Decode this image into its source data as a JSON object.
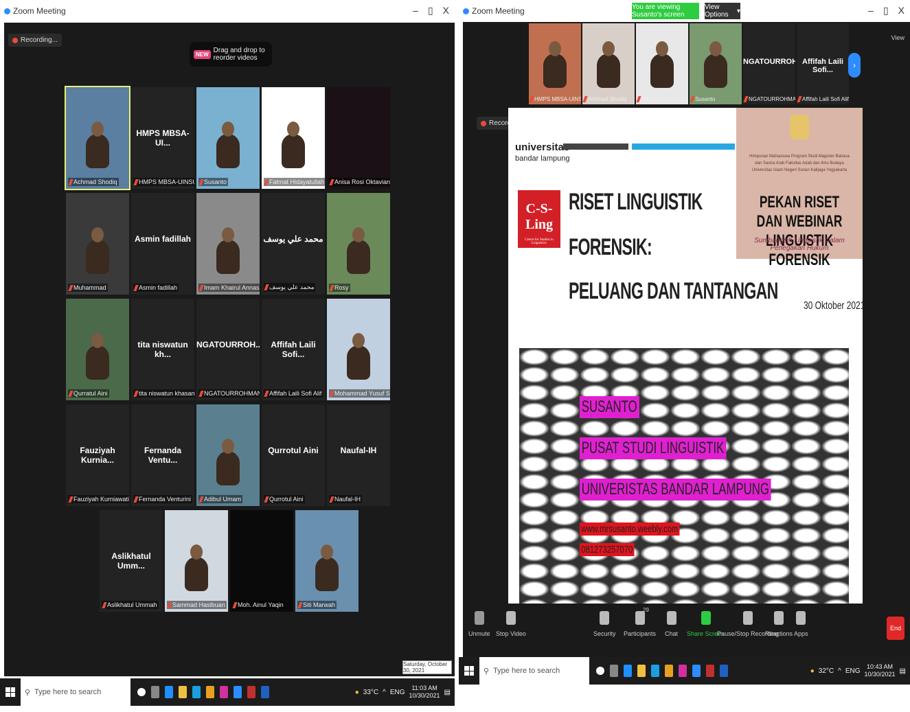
{
  "left": {
    "window_title": "Zoom Meeting",
    "recording_label": "Recording...",
    "drag_badge": "NEW",
    "drag_text": "Drag and drop to reorder videos",
    "tiles": [
      {
        "center": "",
        "name": "Achmad Shodiq"
      },
      {
        "center": "HMPS MBSA-UI...",
        "name": "HMPS MBSA-UINSUKA"
      },
      {
        "center": "",
        "name": "Susanto"
      },
      {
        "center": "",
        "name": "Fatmat Hidayatullah"
      },
      {
        "center": "",
        "name": "Anisa Rosi Oktaviana"
      },
      {
        "center": "",
        "name": "Muhammad"
      },
      {
        "center": "Asmin fadillah",
        "name": "Asmin fadillah"
      },
      {
        "center": "",
        "name": "Imam Khairul Annas"
      },
      {
        "center": "محمد علي يوسف",
        "name": "محمد علي يوسف"
      },
      {
        "center": "",
        "name": "Rosy"
      },
      {
        "center": "",
        "name": "Qurratul Aini"
      },
      {
        "center": "tita niswatun kh...",
        "name": "tita niswatun khasanah"
      },
      {
        "center": "NGATOURROH...",
        "name": "NGATOURROHMAN"
      },
      {
        "center": "Affifah Laili Sofi...",
        "name": "Affifah Laili Sofi Alif"
      },
      {
        "center": "",
        "name": "Mohammad Yusuf Setyawan"
      },
      {
        "center": "Fauziyah Kurnia...",
        "name": "Fauziyah Kurniawati"
      },
      {
        "center": "Fernanda Ventu...",
        "name": "Fernanda Venturini"
      },
      {
        "center": "",
        "name": "Adibul Umam"
      },
      {
        "center": "Qurrotul Aini",
        "name": "Qurrotul Aini"
      },
      {
        "center": "Naufal-IH",
        "name": "Naufal-IH"
      },
      {
        "center": "Aslikhatul Umm...",
        "name": "Aslikhatul Ummah"
      },
      {
        "center": "",
        "name": "Sammad Hasibuan"
      },
      {
        "center": "",
        "name": "Moh. Ainul Yaqin"
      },
      {
        "center": "",
        "name": "Siti Marwah"
      }
    ],
    "date_popup": "Saturday, October 30, 2021",
    "taskbar": {
      "search_placeholder": "Type here to search",
      "temp": "33°C",
      "lang": "ENG",
      "time": "11:03 AM",
      "date": "10/30/2021"
    }
  },
  "right": {
    "window_title": "Zoom Meeting",
    "viewing_label": "You are viewing Susanto's screen",
    "view_options": "View Options",
    "view_label": "View",
    "recording_label": "Recording...",
    "strip": [
      {
        "center": "",
        "name": "HMPS MBSA-UINSUKA"
      },
      {
        "center": "",
        "name": "Achmad Shodiq"
      },
      {
        "center": "",
        "name": "Fatmat Hidayatullah"
      },
      {
        "center": "",
        "name": "Susanto"
      },
      {
        "center": "NGATOURROH...",
        "name": "NGATOURROHMAN"
      },
      {
        "center": "Affifah Laili Sofi...",
        "name": "Affifah Laili Sofi Alif"
      }
    ],
    "slide": {
      "uni_line1": "universitas",
      "uni_line2": "bandar lampung",
      "csl_title": "C-S-Ling",
      "csl_sub": "Centre for Studies in Linguistics",
      "title1": "RISET LINGUISTIK",
      "title2": "FORENSIK:",
      "title3": "PELUANG DAN TANTANGAN",
      "poster_lines": "Himpunan Mahasiswa Program Studi Magister Bahasa dan Sastra Arab Fakultas Adab dan Ilmu Budaya Universitas Islam Negeri Sunan Kalijaga Yogyakarta",
      "poster_big": "PEKAN RISET DAN WEBINAR LINGUISTIK FORENSIK",
      "poster_sub": "Sumbangsih Linguistik Dalam Penegakan Hukum",
      "date": "30 Oktober 2021",
      "name": "SUSANTO",
      "org": "PUSAT STUDI LINGUISTIK",
      "univ": "UNIVERISTAS BANDAR LAMPUNG",
      "site": "www.mrsusanto.weebly.com",
      "phone": "081273257070"
    },
    "toolbar": {
      "unmute": "Unmute",
      "stop_video": "Stop Video",
      "security": "Security",
      "participants": "Participants",
      "participants_count": "29",
      "chat": "Chat",
      "share": "Share Screen",
      "pause": "Pause/Stop Recording",
      "reactions": "Reactions",
      "apps": "Apps",
      "end": "End"
    },
    "taskbar": {
      "search_placeholder": "Type here to search",
      "temp": "32°C",
      "lang": "ENG",
      "time": "10:43 AM",
      "date": "10/30/2021"
    }
  },
  "colors": {
    "zoom_blue": "#2d8cff",
    "share_green": "#2ecc40",
    "end_red": "#e02828",
    "magenta_highlight": "#e020d0"
  }
}
